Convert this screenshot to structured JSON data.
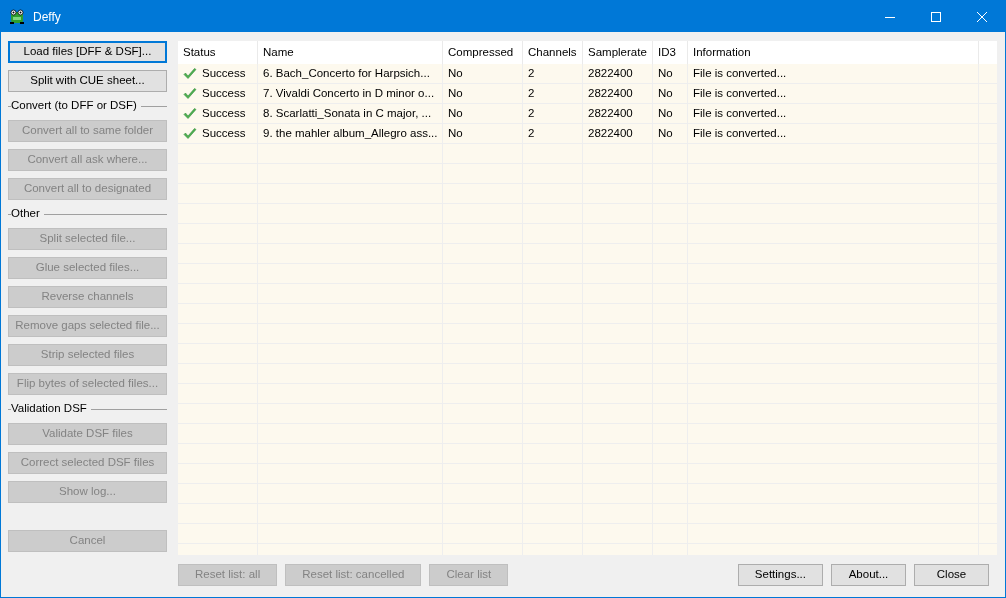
{
  "window": {
    "title": "Deffy"
  },
  "sidebar": [
    {
      "kind": "button",
      "label": "Load files [DFF & DSF]...",
      "disabled": false,
      "focused": true
    },
    {
      "kind": "button",
      "label": "Split with CUE sheet...",
      "disabled": false,
      "focused": false
    },
    {
      "kind": "section",
      "label": "Convert (to DFF or DSF)"
    },
    {
      "kind": "button",
      "label": "Convert all to same folder",
      "disabled": true,
      "focused": false
    },
    {
      "kind": "button",
      "label": "Convert all ask where...",
      "disabled": true,
      "focused": false
    },
    {
      "kind": "button",
      "label": "Convert all to designated",
      "disabled": true,
      "focused": false
    },
    {
      "kind": "section",
      "label": "Other"
    },
    {
      "kind": "button",
      "label": "Split selected file...",
      "disabled": true,
      "focused": false
    },
    {
      "kind": "button",
      "label": "Glue selected files...",
      "disabled": true,
      "focused": false
    },
    {
      "kind": "button",
      "label": "Reverse channels",
      "disabled": true,
      "focused": false
    },
    {
      "kind": "button",
      "label": "Remove gaps selected file...",
      "disabled": true,
      "focused": false
    },
    {
      "kind": "button",
      "label": "Strip selected files",
      "disabled": true,
      "focused": false
    },
    {
      "kind": "button",
      "label": "Flip bytes of selected files...",
      "disabled": true,
      "focused": false
    },
    {
      "kind": "section",
      "label": "Validation DSF"
    },
    {
      "kind": "button",
      "label": "Validate DSF files",
      "disabled": true,
      "focused": false
    },
    {
      "kind": "button",
      "label": "Correct selected DSF files",
      "disabled": true,
      "focused": false
    },
    {
      "kind": "button",
      "label": "Show log...",
      "disabled": true,
      "focused": false
    },
    {
      "kind": "spacer"
    },
    {
      "kind": "button",
      "label": "Cancel",
      "disabled": true,
      "focused": false
    }
  ],
  "table": {
    "columns": [
      "Status",
      "Name",
      "Compressed",
      "Channels",
      "Samplerate",
      "ID3",
      "Information"
    ],
    "rows": [
      {
        "status": "Success",
        "name": "6. Bach_Concerto for Harpsich...",
        "compressed": "No",
        "channels": "2",
        "samplerate": "2822400",
        "id3": "No",
        "information": "File is converted..."
      },
      {
        "status": "Success",
        "name": "7. Vivaldi Concerto in D minor o...",
        "compressed": "No",
        "channels": "2",
        "samplerate": "2822400",
        "id3": "No",
        "information": "File is converted..."
      },
      {
        "status": "Success",
        "name": "8. Scarlatti_Sonata in C major, ...",
        "compressed": "No",
        "channels": "2",
        "samplerate": "2822400",
        "id3": "No",
        "information": "File is converted..."
      },
      {
        "status": "Success",
        "name": "9. the mahler album_Allegro ass...",
        "compressed": "No",
        "channels": "2",
        "samplerate": "2822400",
        "id3": "No",
        "information": "File is converted..."
      }
    ]
  },
  "bottom_left_buttons": [
    {
      "label": "Reset list: all",
      "disabled": true
    },
    {
      "label": "Reset list: cancelled",
      "disabled": true
    },
    {
      "label": "Clear list",
      "disabled": true
    }
  ],
  "bottom_right_buttons": [
    {
      "label": "Settings...",
      "disabled": false
    },
    {
      "label": "About...",
      "disabled": false
    },
    {
      "label": "Close",
      "disabled": false
    }
  ]
}
